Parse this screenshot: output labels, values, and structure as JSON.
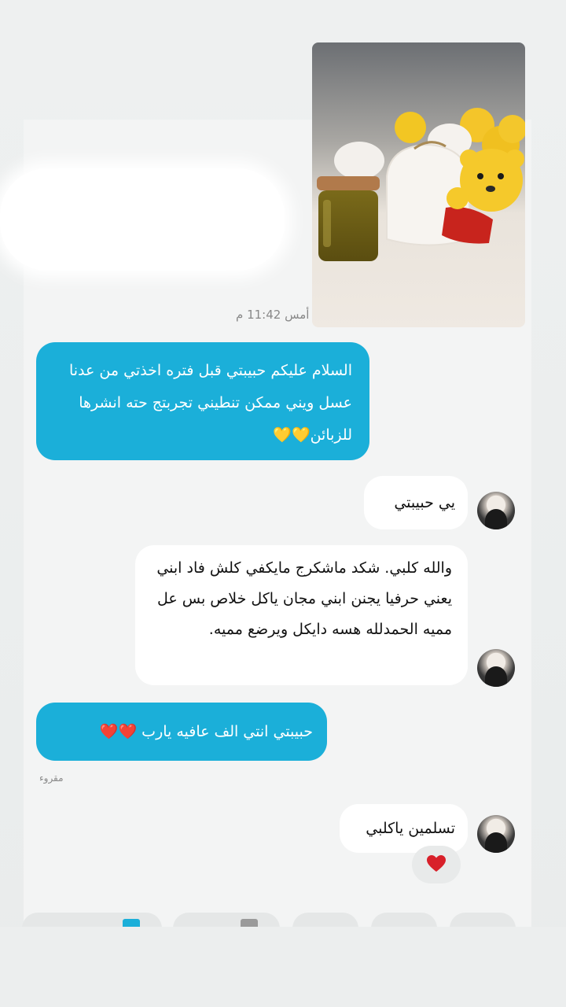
{
  "header": {
    "timestamp": "أمس 11:42 م"
  },
  "messages": [
    {
      "direction": "sent",
      "text": "السلام عليكم حبيبتي قبل فتره اخذتي من عدنا عسل ويني ممكن تنطيني تجربتج حته انشرها للزبائن💛💛"
    },
    {
      "direction": "received",
      "text": "يي حبيبتي"
    },
    {
      "direction": "received",
      "text": "والله كلبي. شكد ماشكرج مايكفي كلش فاد ابني يعني حرفيا يجنن ابني مجان ياكل خلاص بس عل مميه الحمدلله هسه دايكل ويرضع مميه."
    },
    {
      "direction": "sent",
      "text": "حبيبتي انتي الف عافيه يارب ❤️❤️"
    },
    {
      "direction": "received",
      "text": "تسلمين ياكلبي"
    }
  ],
  "status": {
    "read_label": "مقروء"
  },
  "reaction": {
    "icon": "red-heart-icon"
  },
  "colors": {
    "sent_bubble": "#1bafd9",
    "received_bubble": "#ffffff",
    "heart": "#d8202a"
  }
}
